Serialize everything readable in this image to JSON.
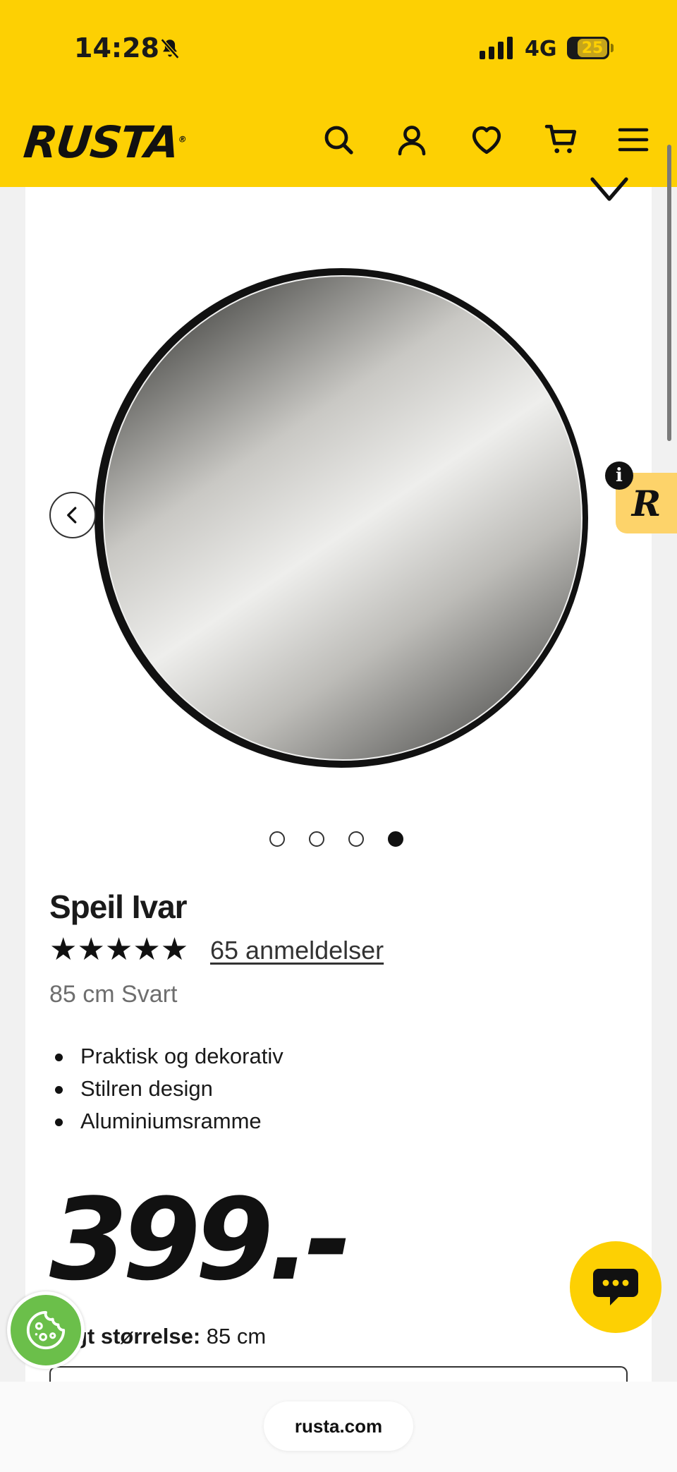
{
  "status_bar": {
    "time": "14:28",
    "network": "4G",
    "battery": "25"
  },
  "header": {
    "logo": "RUSTA",
    "logo_mark": "®"
  },
  "product": {
    "title": "Speil Ivar",
    "stars": "★★★★★",
    "rating": 5,
    "reviews_label": "65 anmeldelser",
    "variant": "85 cm Svart",
    "features": [
      "Praktisk og dekorativ",
      "Stilren design",
      "Aluminiumsramme"
    ],
    "price": "399.-",
    "size_label_visible": "gt størrelse:",
    "size_value": "85 cm"
  },
  "carousel": {
    "slides": 4,
    "active_index": 3
  },
  "badges": {
    "r_badge": "R",
    "info": "i"
  },
  "browser": {
    "url": "rusta.com"
  },
  "colors": {
    "brand_yellow": "#FDD003",
    "cookie_green": "#6bbf4a",
    "text": "#1a1a1a",
    "muted": "#6e6e6e"
  }
}
